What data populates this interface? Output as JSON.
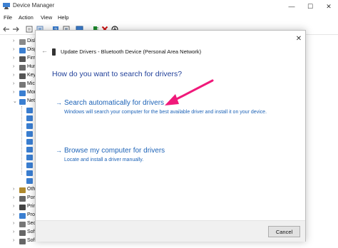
{
  "window": {
    "title": "Device Manager",
    "controls": {
      "minimize": "—",
      "maximize": "☐",
      "close": "✕"
    }
  },
  "menu": [
    "File",
    "Action",
    "View",
    "Help"
  ],
  "toolbar": {
    "icons": [
      "back-arrow-icon",
      "forward-arrow-icon",
      "properties-icon",
      "list-view-icon",
      "help-icon",
      "details-icon",
      "monitor-icon",
      "update-driver-icon",
      "uninstall-icon",
      "download-icon"
    ],
    "colors": {
      "uninstall": "#cc1111",
      "update": "#1c8a2c"
    }
  },
  "tree": {
    "items": [
      {
        "label": "Disk",
        "expander": "›",
        "icon_color": "#8a8a8a"
      },
      {
        "label": "Disp",
        "expander": "›",
        "icon_color": "#3b7fd1"
      },
      {
        "label": "Firm",
        "expander": "›",
        "icon_color": "#555555"
      },
      {
        "label": "Hum",
        "expander": "›",
        "icon_color": "#6a6a6a"
      },
      {
        "label": "Key",
        "expander": "›",
        "icon_color": "#555555"
      },
      {
        "label": "Mic",
        "expander": "›",
        "icon_color": "#777777"
      },
      {
        "label": "Mon",
        "expander": "›",
        "icon_color": "#3b7fd1"
      },
      {
        "label": "Net",
        "expander": "⌄",
        "icon_color": "#3b7fd1"
      }
    ],
    "network_children_count": 10,
    "bottom_items": [
      {
        "label": "Oth",
        "expander": "›",
        "icon_color": "#b08a2e"
      },
      {
        "label": "Port",
        "expander": "›",
        "icon_color": "#666666"
      },
      {
        "label": "Prin",
        "expander": "›",
        "icon_color": "#444444"
      },
      {
        "label": "Proc",
        "expander": "›",
        "icon_color": "#3b7fd1"
      },
      {
        "label": "Sec",
        "expander": "›",
        "icon_color": "#777777"
      },
      {
        "label": "Soft",
        "expander": "›",
        "icon_color": "#666666"
      },
      {
        "label": "Soft",
        "expander": "›",
        "icon_color": "#666666"
      },
      {
        "label": "Sou",
        "expander": "›",
        "icon_color": "#777777"
      }
    ]
  },
  "dialog": {
    "back_glyph": "←",
    "close_glyph": "✕",
    "title": "Update Drivers - Bluetooth Device (Personal Area Network)",
    "question": "How do you want to search for drivers?",
    "options": [
      {
        "arrow": "→",
        "title": "Search automatically for drivers",
        "description": "Windows will search your computer for the best available driver and install it on your device."
      },
      {
        "arrow": "→",
        "title": "Browse my computer for drivers",
        "description": "Locate and install a driver manually."
      }
    ],
    "cancel_label": "Cancel"
  },
  "annotation": {
    "type": "arrow",
    "color": "#f0197a"
  }
}
